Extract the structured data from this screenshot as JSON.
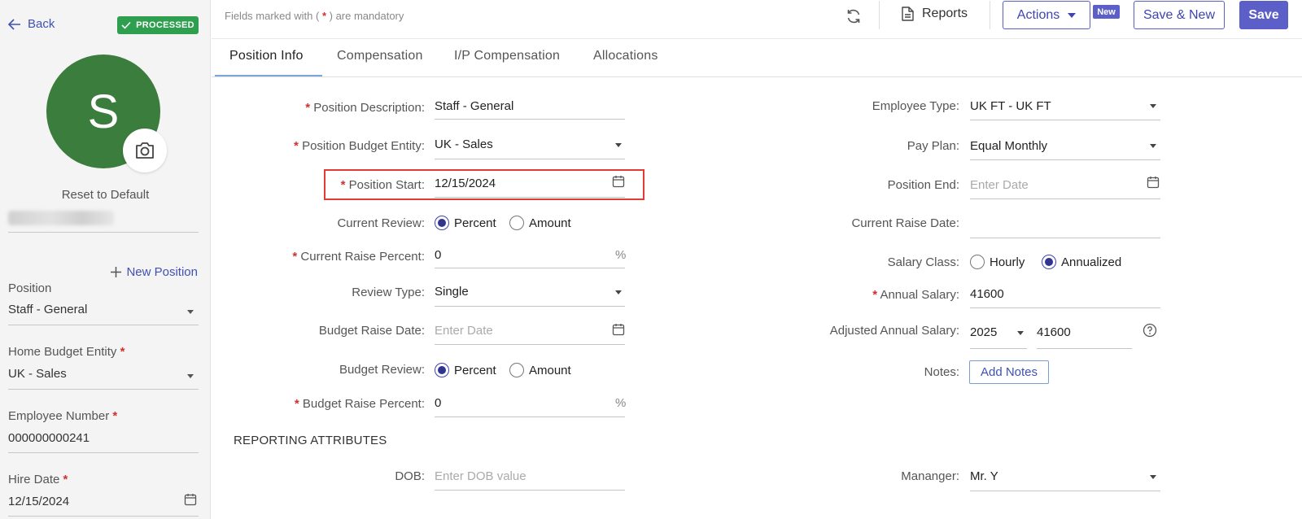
{
  "sidebar": {
    "back_label": "Back",
    "status_badge": "PROCESSED",
    "avatar_initial": "S",
    "reset_label": "Reset to Default",
    "new_position_label": "New Position",
    "position": {
      "label": "Position",
      "value": "Staff - General"
    },
    "home_budget_entity": {
      "label": "Home Budget Entity",
      "value": "UK - Sales"
    },
    "employee_number": {
      "label": "Employee Number",
      "value": "000000000241"
    },
    "hire_date": {
      "label": "Hire Date",
      "value": "12/15/2024"
    }
  },
  "topbar": {
    "mandatory_prefix": "Fields marked with (",
    "mandatory_star": "*",
    "mandatory_suffix": ") are mandatory",
    "reports_label": "Reports",
    "actions_label": "Actions",
    "new_badge": "New",
    "save_new_label": "Save & New",
    "save_label": "Save"
  },
  "tabs": [
    {
      "label": "Position Info",
      "active": true
    },
    {
      "label": "Compensation"
    },
    {
      "label": "I/P Compensation"
    },
    {
      "label": "Allocations"
    }
  ],
  "form": {
    "req_star": "*",
    "position_description": {
      "label": "Position Description:",
      "value": "Staff - General"
    },
    "position_budget_entity": {
      "label": "Position Budget Entity:",
      "value": "UK - Sales"
    },
    "position_start": {
      "label": "Position Start:",
      "value": "12/15/2024"
    },
    "current_review": {
      "label": "Current Review:",
      "option_percent": "Percent",
      "option_amount": "Amount",
      "selected": "Percent"
    },
    "current_raise_percent": {
      "label": "Current Raise Percent:",
      "value": "0",
      "unit": "%"
    },
    "review_type": {
      "label": "Review Type:",
      "value": "Single"
    },
    "budget_raise_date": {
      "label": "Budget Raise Date:",
      "placeholder": "Enter Date"
    },
    "budget_review": {
      "label": "Budget Review:",
      "option_percent": "Percent",
      "option_amount": "Amount",
      "selected": "Percent"
    },
    "budget_raise_percent": {
      "label": "Budget Raise Percent:",
      "value": "0",
      "unit": "%"
    },
    "employee_type": {
      "label": "Employee Type:",
      "value": "UK FT - UK FT"
    },
    "pay_plan": {
      "label": "Pay Plan:",
      "value": "Equal Monthly"
    },
    "position_end": {
      "label": "Position End:",
      "placeholder": "Enter Date"
    },
    "current_raise_date": {
      "label": "Current Raise Date:",
      "value": ""
    },
    "salary_class": {
      "label": "Salary Class:",
      "option_hourly": "Hourly",
      "option_annualized": "Annualized",
      "selected": "Annualized"
    },
    "annual_salary": {
      "label": "Annual Salary:",
      "value": "41600"
    },
    "adjusted_annual_salary": {
      "label": "Adjusted Annual Salary:",
      "year": "2025",
      "value": "41600"
    },
    "notes": {
      "label": "Notes:",
      "button": "Add Notes"
    }
  },
  "reporting": {
    "title": "REPORTING ATTRIBUTES",
    "dob": {
      "label": "DOB:",
      "placeholder": "Enter DOB value"
    },
    "manager": {
      "label": "Mananger:",
      "value": "Mr. Y"
    }
  },
  "colors": {
    "accent": "#5b5fc7",
    "link": "#3f51b5",
    "processed": "#2e9e4f",
    "avatar": "#3b7d3d",
    "required": "#d32f2f",
    "highlight": "#e53935"
  }
}
